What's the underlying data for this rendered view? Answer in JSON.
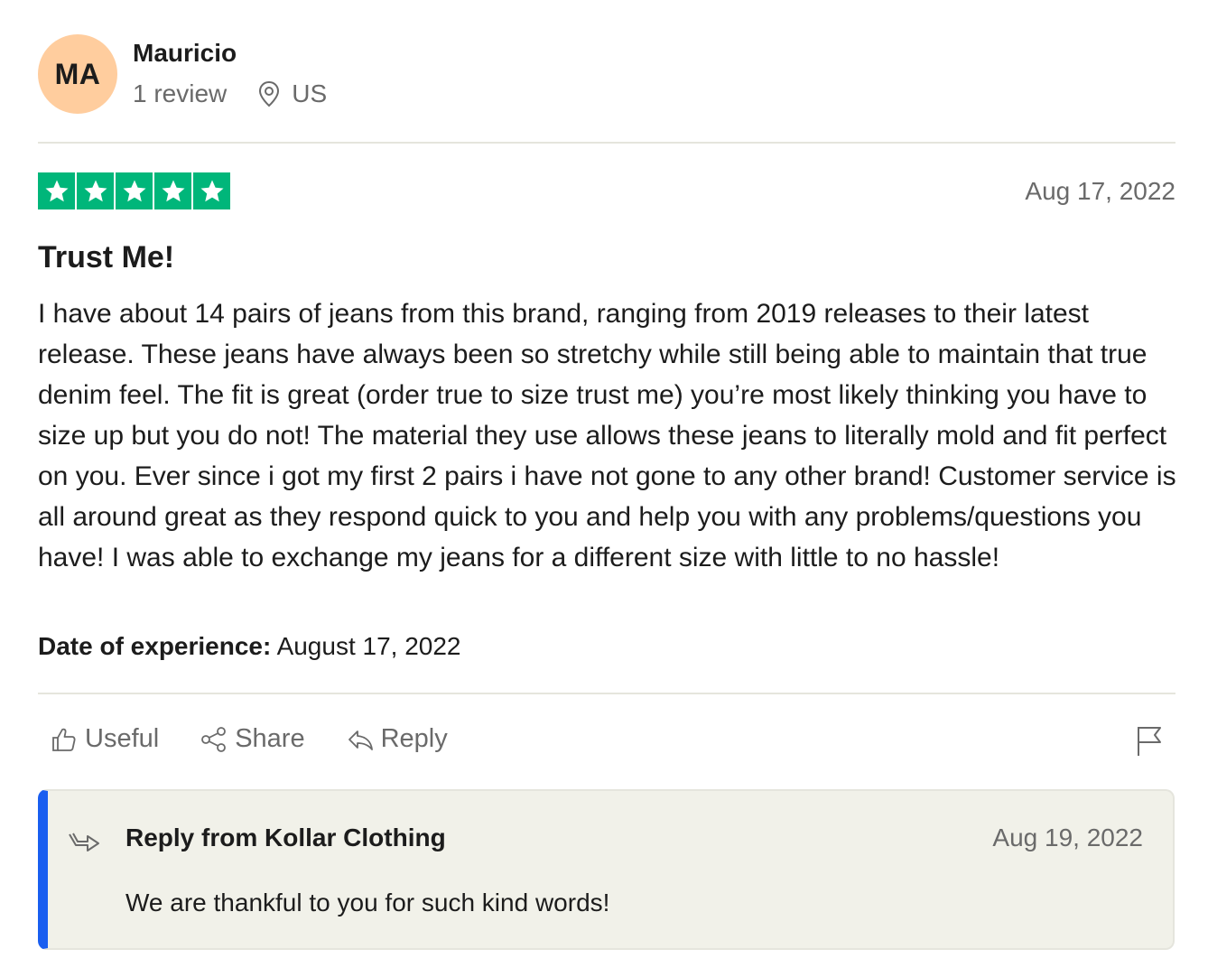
{
  "reviewer": {
    "initials": "MA",
    "name": "Mauricio",
    "review_count": "1 review",
    "location": "US",
    "avatar_color": "#ffcd9e"
  },
  "review": {
    "rating": 5,
    "rating_max": 5,
    "star_color": "#00b67a",
    "date": "Aug 17, 2022",
    "title": "Trust Me!",
    "body": "I have about 14 pairs of jeans from this brand, ranging from 2019 releases to their latest release. These jeans have always been so stretchy while still being able to maintain that true denim feel. The fit is great (order true to size trust me) you’re most likely thinking you have to size up but you do not! The material they use allows these jeans to literally mold and fit perfect on you. Ever since i got my first 2 pairs i have not gone to any other brand! Customer service is all around great as they respond quick to you and help you with any problems/questions you have! I was able to exchange my jeans for a different size with little to no hassle!",
    "experience_label": "Date of experience:",
    "experience_date": "August 17, 2022"
  },
  "actions": {
    "useful": "Useful",
    "share": "Share",
    "reply": "Reply",
    "flag_icon": "flag-icon"
  },
  "company_reply": {
    "title": "Reply from Kollar Clothing",
    "date": "Aug 19, 2022",
    "text": "We are thankful to you for such kind words!",
    "accent_color": "#195ef0"
  }
}
